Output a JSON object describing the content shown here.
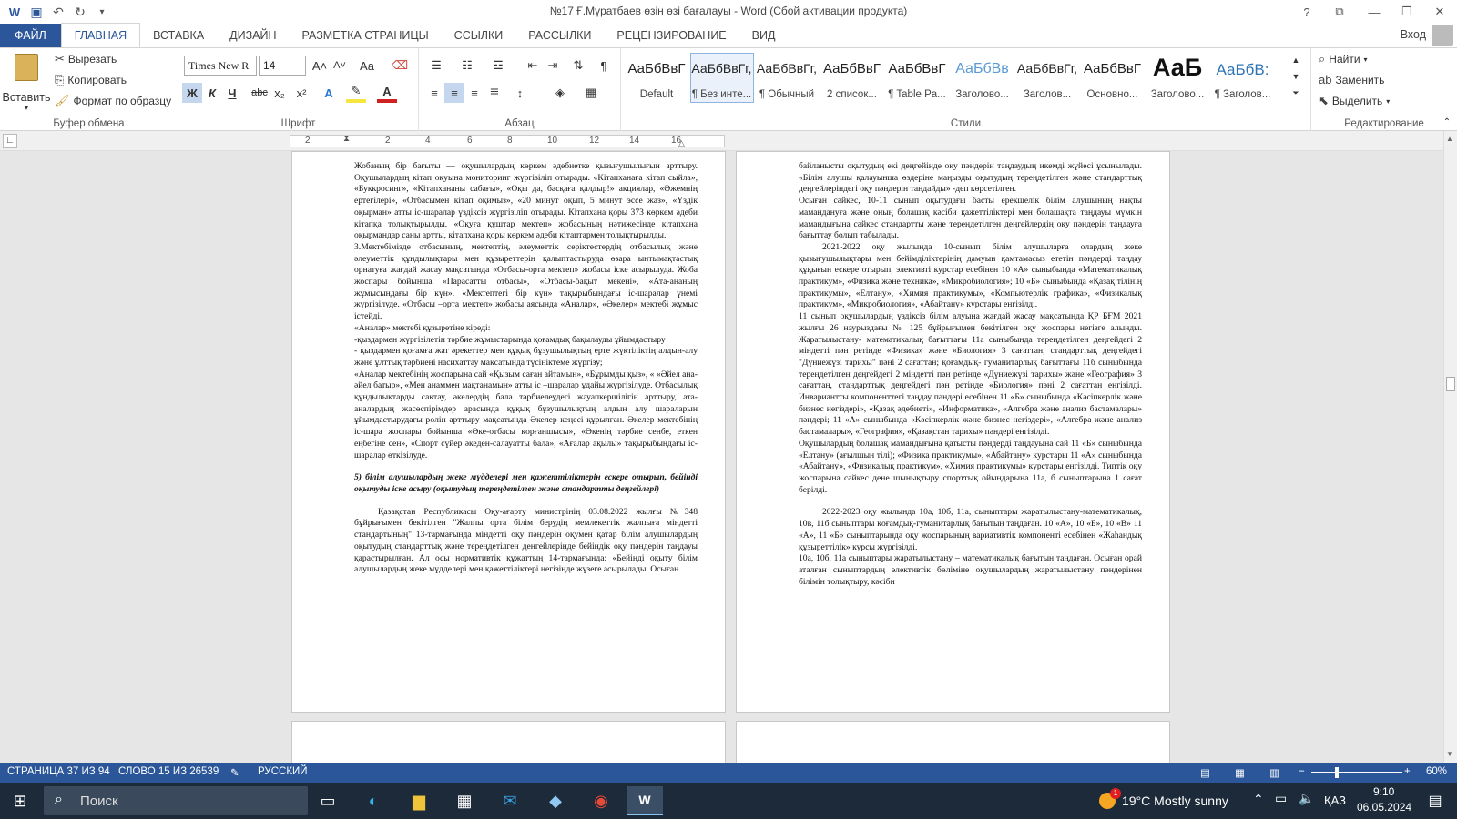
{
  "window": {
    "title": "№17 Ғ.Мұратбаев өзін өзі бағалауы - Word (Сбой активации продукта)",
    "help": "?",
    "controls": [
      "❐",
      "—",
      "❐",
      "✕"
    ]
  },
  "quick_access": {
    "app_icon": "W",
    "save": "💾",
    "undo": "↶",
    "redo": "↻",
    "more": "⁼"
  },
  "tabs": [
    "ФАЙЛ",
    "ГЛАВНАЯ",
    "ВСТАВКА",
    "ДИЗАЙН",
    "РАЗМЕТКА СТРАНИЦЫ",
    "ССЫЛКИ",
    "РАССЫЛКИ",
    "РЕЦЕНЗИРОВАНИЕ",
    "ВИД"
  ],
  "active_tab": "ГЛАВНАЯ",
  "signin": "Вход",
  "clipboard": {
    "label": "Буфер обмена",
    "paste": "Вставить",
    "cut": "Вырезать",
    "copy": "Копировать",
    "format_painter": "Формат по образцу"
  },
  "font": {
    "label": "Шрифт",
    "name": "Times New R",
    "size": "14",
    "grow": "A˄",
    "shrink": "A˅",
    "case": "Aa",
    "bold": "Ж",
    "italic": "К",
    "underline": "Ч",
    "strike": "abc",
    "sub": "x₂",
    "sup": "x²"
  },
  "paragraph": {
    "label": "Абзац"
  },
  "styles": {
    "label": "Стили",
    "items": [
      {
        "preview": "АаБбВвГ",
        "name": "Default"
      },
      {
        "preview": "АаБбВвГг,",
        "name": "¶ Без инте..."
      },
      {
        "preview": "АаБбВвГг,",
        "name": "¶ Обычный"
      },
      {
        "preview": "АаБбВвГ",
        "name": "2 список..."
      },
      {
        "preview": "АаБбВвГ",
        "name": "¶ Table Pa..."
      },
      {
        "preview": "АаБбВв",
        "name": "Заголово..."
      },
      {
        "preview": "АаБбВвГг,",
        "name": "Заголов..."
      },
      {
        "preview": "АаБбВвГ",
        "name": "Основно..."
      },
      {
        "preview": "АаБ",
        "name": "Заголово..."
      },
      {
        "preview": "АаБбВ:",
        "name": "¶ Заголов..."
      }
    ]
  },
  "editing": {
    "label": "Редактирование",
    "find": "Найти",
    "replace": "Заменить",
    "select": "Выделить"
  },
  "ruler": {
    "marks": [
      "2",
      "2",
      "4",
      "6",
      "8",
      "10",
      "12",
      "14",
      "16"
    ]
  },
  "page_left": [
    {
      "text": "Жобаның бір бағыты — оқушылардың көркем әдебиетке қызығушылығын арттыру. Оқушылардың кітап оқуына мониторинг жүргізіліп отырады. «Кітапханаға кітап сыйла», «Буккросинг», «Кітапхананы сабағы», «Оқы да, басқаға қалдыр!» акциялар, «Әжемнің ертегілері», «Отбасымен кітап оқимыз», «20 минут оқып, 5 минут эссе жаз», «Үздік оқырман» атты іс-шаралар үздіксіз жүргізіліп отырады. Кітапхана қоры 373 көркем әдеби кітапқа толықтырылды. «Оқуға құштар мектеп» жобасының нәтижесінде кітапхана оқырмандар саны артты, кітапхана қоры көркем әдеби кітаптармен толықтырылды.",
      "cls": ""
    },
    {
      "text": "3.Мектебімізде отбасының, мектептің, әлеуметтік серіктестердің отбасылық және әлеуметтік құндылықтары мен құзыреттерін қалыптастыруда өзара ынтымақтастық орнатуға жағдай жасау мақсатында «Отбасы-орта мектеп» жобасы іске асырылуда. Жоба жоспары бойынша «Парасатты отбасы», «Отбасы-бақыт мекені», «Ата-ананың жұмысындағы бір күн». «Мектептегі бір күн» тақырыбындағы іс-шаралар үнемі жүргізілуде. «Отбасы –орта мектеп» жобасы аясында «Аналар», «Әкелер» мектебі жұмыс істейді.",
      "cls": ""
    },
    {
      "text": "«Аналар» мектебі құзыретіне кіреді:",
      "cls": ""
    },
    {
      "text": "-қыздармен жүргізілетін тәрбие жұмыстарында қоғамдық бақылауды ұйымдастыру",
      "cls": ""
    },
    {
      "text": "- қыздармен қоғамға жат әрекеттер мен құқық бұзушылықтың ерте жүктіліктің алдын-алу және ұлттық тәрбиені насихаттау мақсатында түсініктеме жүргізу;",
      "cls": ""
    },
    {
      "text": "«Аналар мектебінің жоспарына сай «Қызым саған айтамын», «Бұрымды қыз», « «Әйел ана-әйел батыр», «Мен анаммен мақтанамын» атты іс –шаралар ұдайы жүргізілуде. Отбасылық құндылықтарды сақтау, әкелердің бала тәрбиелеудегі жауапкершілігін арттыру, ата-аналардың жасөспірімдер арасында құқық бұзушылықтың алдын алу шараларын ұйымдастырудағы рөлін арттыру мақсатында Әкелер кеңесі құрылған. Әкелер мектебінің іс-шара жоспары бойынша «Әке-отбасы қорғаншысы», «Әкенің тәрбие сенбе, еткен еңбегіне сен», «Спорт сүйер әкеден-салауатты бала», «Ағалар ақылы» тақырыбындағы іс-шаралар өткізілуде.",
      "cls": ""
    },
    {
      "text": "5) білім алушылардың жеке мүдделері мен қажеттіліктерін ескере отырып, бейінді оқытуды іске асыру (оқытудың тереңдетілген және стандартты деңгейлері)",
      "cls": "bi gap"
    },
    {
      "text": "Қазақстан Республикасы Оқу-ағарту министрінің 03.08.2022 жылғы №348 бұйрығымен бекітілген \"Жалпы орта білім берудің мемлекеттік жалпыға міндетті стандартының\" 13-тармағында міндетті оқу пәндерін оқумен қатар білім алушылардың оқытудың стандарттық және тереңдетілген деңгейлерінде бейіндік оқу пәндерін таңдауы қарастырылған. Ал осы нормативтік құжаттың 14-тармағында: «Бейінді оқыту білім алушылардың жеке мүдделері мен қажеттіліктері негізінде жүзеге асырылады. Осыған",
      "cls": "ind gap"
    }
  ],
  "page_right": [
    {
      "text": "байланысты оқытудың екі деңгейінде оқу пәндерін таңдаудың икемді жүйесі ұсынылады. «Білім алушы қалауынша өздеріне маңызды оқытудың тереңдетілген және стандарттық деңгейлеріндегі оқу пәндерін таңдайды» -деп көрсетілген.",
      "cls": ""
    },
    {
      "text": "Осыған сәйкес, 10-11 сынып оқытудағы басты ерекшелік білім алушының нақты мамандануға және оның болашақ кәсіби қажеттіліктері мен болашақта таңдауы мүмкін мамандығына сәйкес стандартты және тереңдетілген деңгейлердің оқу пәндерін таңдауға бағыттау болып табылады.",
      "cls": ""
    },
    {
      "text": "2021-2022 оқу жылында 10-сынып білім алушыларға олардың жеке қызығушылықтары мен бейімділіктерінің дамуын қамтамасыз ететін пәндерді таңдау құқығын ескере отырып, элективті курстар есебінен 10 «А» сыныбында «Математикалық практикум», «Физика және техника», «Микробиология»; 10 «Б» сыныбында «Қазақ тілінің практикумы», «Елтану», «Химия практикумы», «Компьютерлік графика», «Физикалық практикум», «Микробиология», «Абайтану» курстары енгізілді.",
      "cls": "ind"
    },
    {
      "text": "11 сынып оқушылардың үздіксіз білім алуына жағдай жасау мақсатында ҚР БҒМ 2021 жылғы 26 наурыздағы № 125 бұйрығымен бекітілген оқу жоспары негізге алынды. Жаратылыстану- математикалық бағыттағы 11а сыныбында тереңдетілген деңгейдегі 2 міндетті пән ретінде «Физика» және «Биология» 3 сағаттан, стандарттық деңгейдегі \"Дүниежүзі тарихы\" пәні 2 сағаттан; қоғамдық- гуманитарлық бағыттағы 11б сыныбында тереңдетілген деңгейдегі 2 міндетті пән ретінде «Дүниежүзі тарихы» және «География» 3 сағаттан, стандарттық деңгейдегі пән ретінде «Биология» пәні 2 сағаттан енгізілді. Инвариантты компоненттегі таңдау пәндері есебінен 11 «Б» сыныбында «Кәсіпкерлік және бизнес негіздері», «Қазақ әдебиеті», «Информатика», «Алгебра және анализ бастамалары» пәндері; 11 «А» сыныбында «Кәсіпкерлік және бизнес негіздері», «Алгебра және анализ бастамалары», «География», «Қазақстан тарихы» пәндері енгізілді.",
      "cls": ""
    },
    {
      "text": "Оқушылардың болашақ мамандығына қатысты пәндерді таңдауына сай 11 «Б» сыныбында «Елтану» (ағылшын тілі); «Физика практикумы», «Абайтану» курстары 11 «А» сыныбында «Абайтану», «Физикалық практикум», «Химия практикумы» курстары енгізілді. Типтік оқу жоспарына сәйкес дене шынықтыру спорттық ойындарына 11а, б сыныптарына 1 сағат берілді.",
      "cls": ""
    },
    {
      "text": "2022-2023 оқу жылында 10а, 10б, 11а, сыныптары жаратылыстану-математикалық, 10в, 11б сыныптары қоғамдық-гуманитарлық бағытын таңдаған. 10 «А», 10 «Б», 10 «В» 11 «А», 11 «Б» сыныптарында оқу жоспарының вариативтік компоненті есебінен «Жаһандық құзыреттілік» курсы жүргізілді.",
      "cls": "ind gap"
    },
    {
      "text": "10а, 10б, 11а сыныптары жаратылыстану – математикалық бағытын таңдаған. Осыған орай аталған сыныптардың элективтік бөліміне оқушылардың жаратылыстану пәндерінен білімін толықтыру, кәсіби",
      "cls": ""
    }
  ],
  "status": {
    "page": "СТРАНИЦА 37 ИЗ 94",
    "words": "СЛОВО 15 ИЗ 26539",
    "lang": "РУССКИЙ",
    "zoom": "60%"
  },
  "taskbar": {
    "search": "Поиск",
    "weather": "19°C  Mostly sunny",
    "lang": "ҚАЗ",
    "time": "9:10",
    "date": "06.05.2024",
    "notif": "1"
  }
}
